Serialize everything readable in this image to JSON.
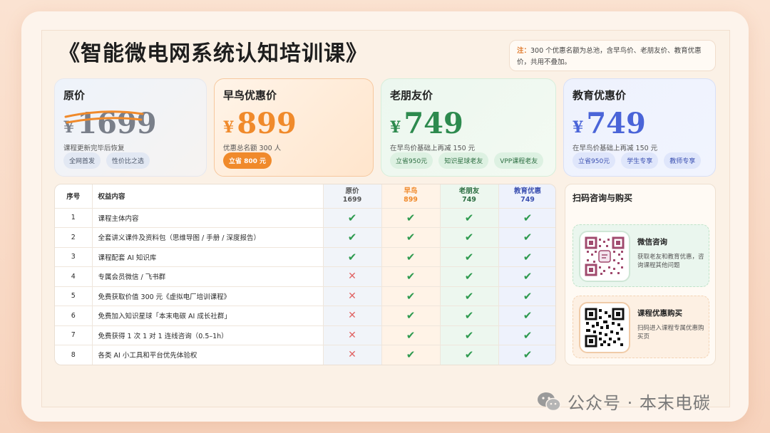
{
  "title": "《智能微电网系统认知培训课》",
  "note": {
    "label": "注：",
    "text": "300 个优惠名额为总池，含早鸟价、老朋友价、教育优惠价，共用不叠加。"
  },
  "cards": {
    "orig": {
      "title": "原价",
      "currency": "¥",
      "price": "1699",
      "sub": "课程更新完毕后恢复",
      "tags": [
        "全网首发",
        "性价比之选"
      ]
    },
    "early": {
      "title": "早鸟优惠价",
      "currency": "¥",
      "price": "899",
      "sub": "优惠总名额 300 人",
      "tags": [
        "立省 800 元"
      ]
    },
    "friend": {
      "title": "老朋友价",
      "currency": "¥",
      "price": "749",
      "sub": "在早鸟价基础上再减 150 元",
      "tags": [
        "立省950元",
        "知识星球老友",
        "VPP课程老友"
      ]
    },
    "edu": {
      "title": "教育优惠价",
      "currency": "¥",
      "price": "749",
      "sub": "在早鸟价基础上再减 150 元",
      "tags": [
        "立省950元",
        "学生专享",
        "教师专享"
      ]
    }
  },
  "table": {
    "headers": {
      "no": "序号",
      "item": "权益内容",
      "orig": [
        "原价",
        "1699"
      ],
      "early": [
        "早鸟",
        "899"
      ],
      "friend": [
        "老朋友",
        "749"
      ],
      "edu": [
        "教育优惠",
        "749"
      ]
    },
    "check": "✔",
    "cross": "✕",
    "rows": [
      {
        "no": "1",
        "item": "课程主体内容",
        "orig": true,
        "early": true,
        "friend": true,
        "edu": true
      },
      {
        "no": "2",
        "item": "全套讲义课件及资料包（思维导图 / 手册 / 深度报告）",
        "orig": true,
        "early": true,
        "friend": true,
        "edu": true
      },
      {
        "no": "3",
        "item": "课程配套 AI 知识库",
        "orig": true,
        "early": true,
        "friend": true,
        "edu": true
      },
      {
        "no": "4",
        "item": "专属会员微信 / 飞书群",
        "orig": false,
        "early": true,
        "friend": true,
        "edu": true
      },
      {
        "no": "5",
        "item": "免费获取价值 300 元《虚拟电厂培训课程》",
        "orig": false,
        "early": true,
        "friend": true,
        "edu": true
      },
      {
        "no": "6",
        "item": "免费加入知识星球「本末电碳 AI 成长社群」",
        "orig": false,
        "early": true,
        "friend": true,
        "edu": true
      },
      {
        "no": "7",
        "item": "免费获得 1 次 1 对 1 连线咨询（0.5–1h）",
        "orig": false,
        "early": true,
        "friend": true,
        "edu": true
      },
      {
        "no": "8",
        "item": "各类 AI 小工具和平台优先体验权",
        "orig": false,
        "early": true,
        "friend": true,
        "edu": true
      }
    ]
  },
  "side": {
    "title": "扫码咨询与购买",
    "wechat": {
      "name": "微信咨询",
      "desc": "获取老友和教育优惠，咨询课程其他问题"
    },
    "buy": {
      "name": "课程优惠购买",
      "desc": "扫码进入课程专属优惠购买页"
    }
  },
  "watermark": "公众号 · 本末电碳",
  "colors": {
    "early": "#f08a2b",
    "friend": "#2d8a4e",
    "edu": "#4a64d8",
    "check": "#2e9a4f",
    "cross": "#e06464"
  }
}
